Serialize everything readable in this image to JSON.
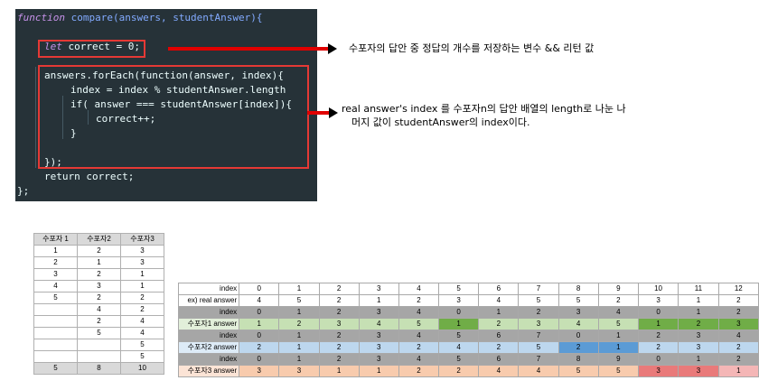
{
  "code": {
    "lines": [
      [
        "function",
        " compare(answers, studentAnswer){"
      ],
      [
        "let",
        " correct = 0;"
      ],
      [
        "answers.forEach(function(answer, index){"
      ],
      [
        "index = index % studentAnswer.length"
      ],
      [
        "if( answer === studentAnswer[index]){"
      ],
      [
        "correct++;"
      ],
      [
        "}"
      ],
      [
        "});"
      ],
      [
        "return correct;"
      ],
      [
        "};"
      ]
    ]
  },
  "notes": {
    "first": "수포자의 답안 중 정답의 개수를 저장하는 변수 && 리턴 값",
    "second_line1": "real answer's index 를 수포자n의 답안 배열의 length로 나눈 나",
    "second_line2": "머지 값이 studentAnswer의 index이다."
  },
  "small_table": {
    "headers": [
      "수포자 1",
      "수포자2",
      "수포자3"
    ],
    "rows": [
      [
        "1",
        "2",
        "3"
      ],
      [
        "2",
        "1",
        "3"
      ],
      [
        "3",
        "2",
        "1"
      ],
      [
        "4",
        "3",
        "1"
      ],
      [
        "5",
        "2",
        "2"
      ],
      [
        "",
        "4",
        "2"
      ],
      [
        "",
        "2",
        "4"
      ],
      [
        "",
        "5",
        "4"
      ],
      [
        "",
        "",
        "5"
      ],
      [
        "",
        "",
        "5"
      ]
    ],
    "totals": [
      "5",
      "8",
      "10"
    ]
  },
  "big_table": {
    "header_label": "index",
    "header": [
      "0",
      "1",
      "2",
      "3",
      "4",
      "5",
      "6",
      "7",
      "8",
      "9",
      "10",
      "11",
      "12"
    ],
    "rows": [
      {
        "label": "ex) real answer",
        "cls": "row-header",
        "values": [
          "4",
          "5",
          "2",
          "1",
          "2",
          "3",
          "4",
          "5",
          "5",
          "2",
          "3",
          "1",
          "2"
        ]
      },
      {
        "label": "index",
        "cls": "row-idx",
        "values": [
          "0",
          "1",
          "2",
          "3",
          "4",
          "0",
          "1",
          "2",
          "3",
          "4",
          "0",
          "1",
          "2"
        ]
      },
      {
        "label": "수포자1 answer",
        "cls": "row-s1",
        "values": [
          "1",
          "2",
          "3",
          "4",
          "5",
          "1",
          "2",
          "3",
          "4",
          "5",
          "1",
          "2",
          "3"
        ]
      },
      {
        "label": "index",
        "cls": "row-idx",
        "values": [
          "0",
          "1",
          "2",
          "3",
          "4",
          "5",
          "6",
          "7",
          "0",
          "1",
          "2",
          "3",
          "4"
        ]
      },
      {
        "label": "수포자2 answer",
        "cls": "row-s2",
        "values": [
          "2",
          "1",
          "2",
          "3",
          "2",
          "4",
          "2",
          "5",
          "2",
          "1",
          "2",
          "3",
          "2"
        ]
      },
      {
        "label": "index",
        "cls": "row-idx",
        "values": [
          "0",
          "1",
          "2",
          "3",
          "4",
          "5",
          "6",
          "7",
          "8",
          "9",
          "0",
          "1",
          "2"
        ]
      },
      {
        "label": "수포자3 answer",
        "cls": "row-s3",
        "values": [
          "3",
          "3",
          "1",
          "1",
          "2",
          "2",
          "4",
          "4",
          "5",
          "5",
          "3",
          "3",
          "1"
        ]
      }
    ]
  }
}
